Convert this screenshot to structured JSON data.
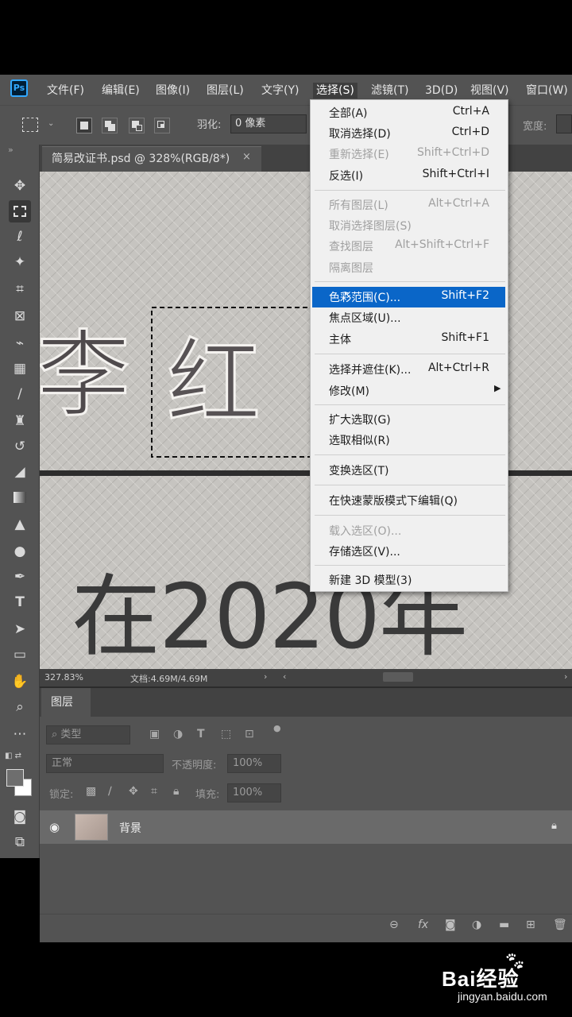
{
  "menubar": {
    "items": [
      "文件(F)",
      "编辑(E)",
      "图像(I)",
      "图层(L)",
      "文字(Y)",
      "选择(S)",
      "滤镜(T)",
      "3D(D)",
      "视图(V)",
      "窗口(W)"
    ],
    "active_index": 5
  },
  "options_bar": {
    "feather_label": "羽化:",
    "feather_value": "0 像素",
    "width_label": "宽度:"
  },
  "document": {
    "tab_title": "简易改证书.psd @ 328%(RGB/8*)",
    "close_glyph": "×"
  },
  "canvas_text": {
    "line1_char1": "李",
    "line1_char2": "红",
    "line2": "在2020年"
  },
  "status_bar": {
    "zoom": "327.83%",
    "doc_size": "文档:4.69M/4.69M"
  },
  "select_menu": {
    "items": [
      {
        "label": "全部(A)",
        "shortcut": "Ctrl+A",
        "disabled": false
      },
      {
        "label": "取消选择(D)",
        "shortcut": "Ctrl+D",
        "disabled": false
      },
      {
        "label": "重新选择(E)",
        "shortcut": "Shift+Ctrl+D",
        "disabled": true
      },
      {
        "label": "反选(I)",
        "shortcut": "Shift+Ctrl+I",
        "disabled": false
      },
      {
        "label": "所有图层(L)",
        "shortcut": "Alt+Ctrl+A",
        "disabled": true
      },
      {
        "label": "取消选择图层(S)",
        "shortcut": "",
        "disabled": true
      },
      {
        "label": "查找图层",
        "shortcut": "Alt+Shift+Ctrl+F",
        "disabled": true
      },
      {
        "label": "隔离图层",
        "shortcut": "",
        "disabled": true
      },
      {
        "label": "色彩范围(C)...",
        "shortcut": "Shift+F2",
        "disabled": false,
        "highlighted": true
      },
      {
        "label": "焦点区域(U)...",
        "shortcut": "",
        "disabled": false
      },
      {
        "label": "主体",
        "shortcut": "Shift+F1",
        "disabled": false
      },
      {
        "label": "选择并遮住(K)...",
        "shortcut": "Alt+Ctrl+R",
        "disabled": false
      },
      {
        "label": "修改(M)",
        "shortcut": "",
        "disabled": false,
        "submenu": true
      },
      {
        "label": "扩大选取(G)",
        "shortcut": "",
        "disabled": false
      },
      {
        "label": "选取相似(R)",
        "shortcut": "",
        "disabled": false
      },
      {
        "label": "变换选区(T)",
        "shortcut": "",
        "disabled": false
      },
      {
        "label": "在快速蒙版模式下编辑(Q)",
        "shortcut": "",
        "disabled": false
      },
      {
        "label": "载入选区(O)...",
        "shortcut": "",
        "disabled": true
      },
      {
        "label": "存储选区(V)...",
        "shortcut": "",
        "disabled": false
      },
      {
        "label": "新建 3D 模型(3)",
        "shortcut": "",
        "disabled": false
      }
    ]
  },
  "layers_panel": {
    "tab": "图层",
    "filter_kind": "类型",
    "blend_mode": "正常",
    "opacity_label": "不透明度:",
    "opacity_value": "100%",
    "lock_label": "锁定:",
    "fill_label": "填充:",
    "fill_value": "100%",
    "layer_name": "背景"
  },
  "watermark": {
    "brand": "Bai经验",
    "url": "jingyan.baidu.com"
  },
  "colors": {
    "menu_highlight": "#0a66c8",
    "panel": "#535353",
    "ps_blue": "#31a8ff"
  }
}
